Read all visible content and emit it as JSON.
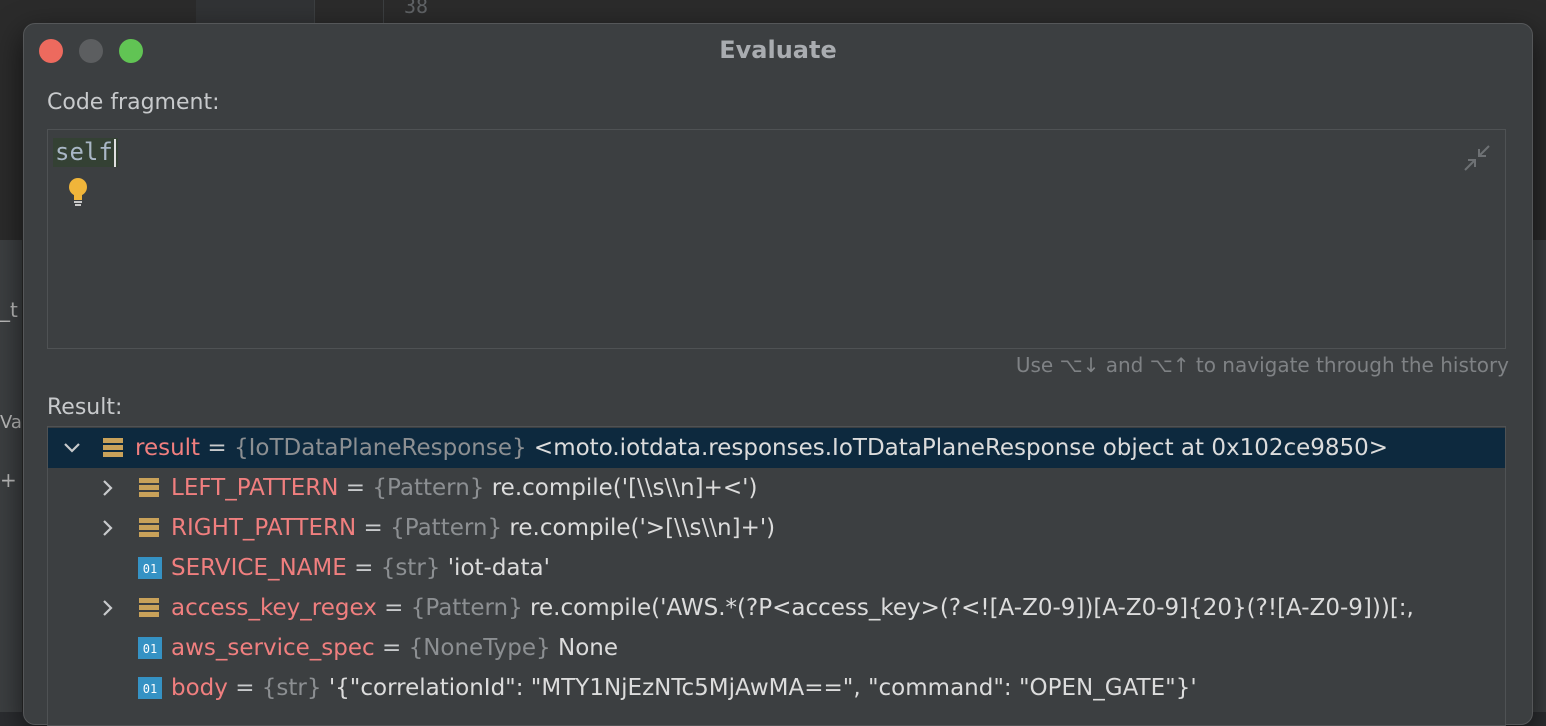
{
  "background": {
    "line_number": "38",
    "left_fragments": [
      "_t",
      "Va",
      "+"
    ]
  },
  "dialog": {
    "title": "Evaluate",
    "code_label": "Code fragment:",
    "code_text": "self",
    "hint": "Use ⌥↓ and ⌥↑ to navigate through the history",
    "result_label": "Result:"
  },
  "tree": [
    {
      "name": "result",
      "eq": " = ",
      "type": "{IoTDataPlaneResponse}",
      "value": " <moto.iotdata.responses.IoTDataPlaneResponse object at 0x102ce9850>",
      "icon": "object-icon",
      "expandable": true,
      "expanded": true
    },
    {
      "name": "LEFT_PATTERN",
      "eq": " = ",
      "type": "{Pattern}",
      "value": " re.compile('[\\\\s\\\\n]+<')",
      "icon": "object-icon",
      "expandable": true,
      "expanded": false
    },
    {
      "name": "RIGHT_PATTERN",
      "eq": " = ",
      "type": "{Pattern}",
      "value": " re.compile('>[\\\\s\\\\n]+')",
      "icon": "object-icon",
      "expandable": true,
      "expanded": false
    },
    {
      "name": "SERVICE_NAME",
      "eq": " = ",
      "type": "{str}",
      "value": " 'iot-data'",
      "icon": "primitive-icon",
      "expandable": false,
      "expanded": false
    },
    {
      "name": "access_key_regex",
      "eq": " = ",
      "type": "{Pattern}",
      "value": " re.compile('AWS.*(?P<access_key>(?<![A-Z0-9])[A-Z0-9]{20}(?![A-Z0-9]))[:,",
      "icon": "object-icon",
      "expandable": true,
      "expanded": false
    },
    {
      "name": "aws_service_spec",
      "eq": " = ",
      "type": "{NoneType}",
      "value": " None",
      "icon": "primitive-icon",
      "expandable": false,
      "expanded": false
    },
    {
      "name": "body",
      "eq": " = ",
      "type": "{str}",
      "value": " '{\"correlationId\": \"MTY1NjEzNTc5MjAwMA==\", \"command\": \"OPEN_GATE\"}'",
      "icon": "primitive-icon",
      "expandable": false,
      "expanded": false
    }
  ],
  "colors": {
    "selection": "#0d293e",
    "name": "#f07f7f",
    "type": "#8c8f92",
    "object_icon": "#c9a25a",
    "primitive_icon": "#3592c4"
  }
}
